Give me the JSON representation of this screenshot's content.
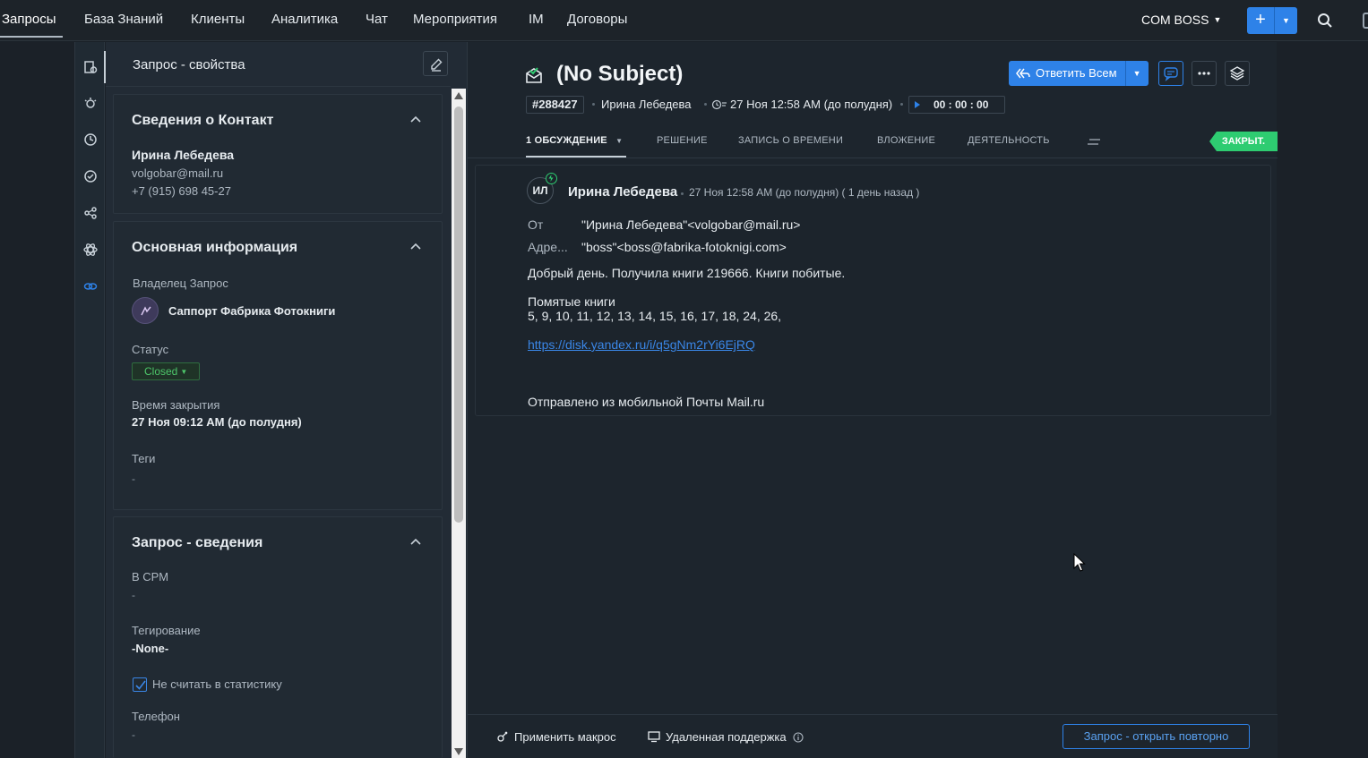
{
  "nav": {
    "items": [
      "Запросы",
      "База Знаний",
      "Клиенты",
      "Аналитика",
      "Чат",
      "Мероприятия",
      "IM",
      "Договоры"
    ],
    "org": "COM BOSS"
  },
  "props": {
    "title": "Запрос - свойства",
    "contact": {
      "title": "Сведения о Контакт",
      "name": "Ирина Лебедева",
      "email": "volgobar@mail.ru",
      "phone": "+7 (915) 698 45-27"
    },
    "basic": {
      "title": "Основная информация",
      "owner_label": "Владелец Запрос",
      "owner_value": "Саппорт Фабрика Фотокниги",
      "status_label": "Статус",
      "status_value": "Closed",
      "closed_label": "Время закрытия",
      "closed_value": "27 Ноя 09:12 AM (до полудня)",
      "tags_label": "Теги",
      "tags_value": "-"
    },
    "details": {
      "title": "Запрос - сведения",
      "crm_label": "В СРМ",
      "crm_value": "-",
      "tagging_label": "Тегирование",
      "tagging_value": "-None-",
      "nostats_label": "Не считать в статистику",
      "nostats_checked": true,
      "phone_label": "Телефон",
      "phone_value": "-"
    }
  },
  "ticket": {
    "subject": "(No Subject)",
    "reply_all": "Ответить Всем",
    "id": "#288427",
    "agent": "Ирина Лебедева",
    "date": "27 Ноя 12:58 AM (до полудня)",
    "timer": "00 : 00 : 00",
    "tabs": [
      "1 ОБСУЖДЕНИЕ",
      "РЕШЕНИЕ",
      "ЗАПИСЬ О ВРЕМЕНИ",
      "ВЛОЖЕНИЕ",
      "ДЕЯТЕЛЬНОСТЬ"
    ],
    "status_ribbon": "ЗАКРЫТ."
  },
  "message": {
    "initials": "ИЛ",
    "sender": "Ирина Лебедева",
    "time": "27 Ноя 12:58 AM (до полудня) ( 1 день назад )",
    "from_label": "От",
    "from_value": "\"Ирина Лебедева\"<volgobar@mail.ru>",
    "to_label": "Адре...",
    "to_value": "\"boss\"<boss@fabrika-fotoknigi.com>",
    "line1": "Добрый день. Получила книги 219666. Книги побитые.",
    "line2": "Помятые книги",
    "line3": "5, 9, 10, 11, 12, 13, 14, 15, 16, 17, 18, 24, 26,",
    "link": "https://disk.yandex.ru/i/q5gNm2rYi6EjRQ",
    "signature": "Отправлено из мобильной Почты Mail.ru"
  },
  "footer": {
    "macro": "Применить макрос",
    "remote": "Удаленная поддержка",
    "reopen": "Запрос - открыть повторно"
  },
  "colors": {
    "accent": "#2e82e8",
    "closed": "#2ecc71",
    "background": "#1d252d"
  }
}
